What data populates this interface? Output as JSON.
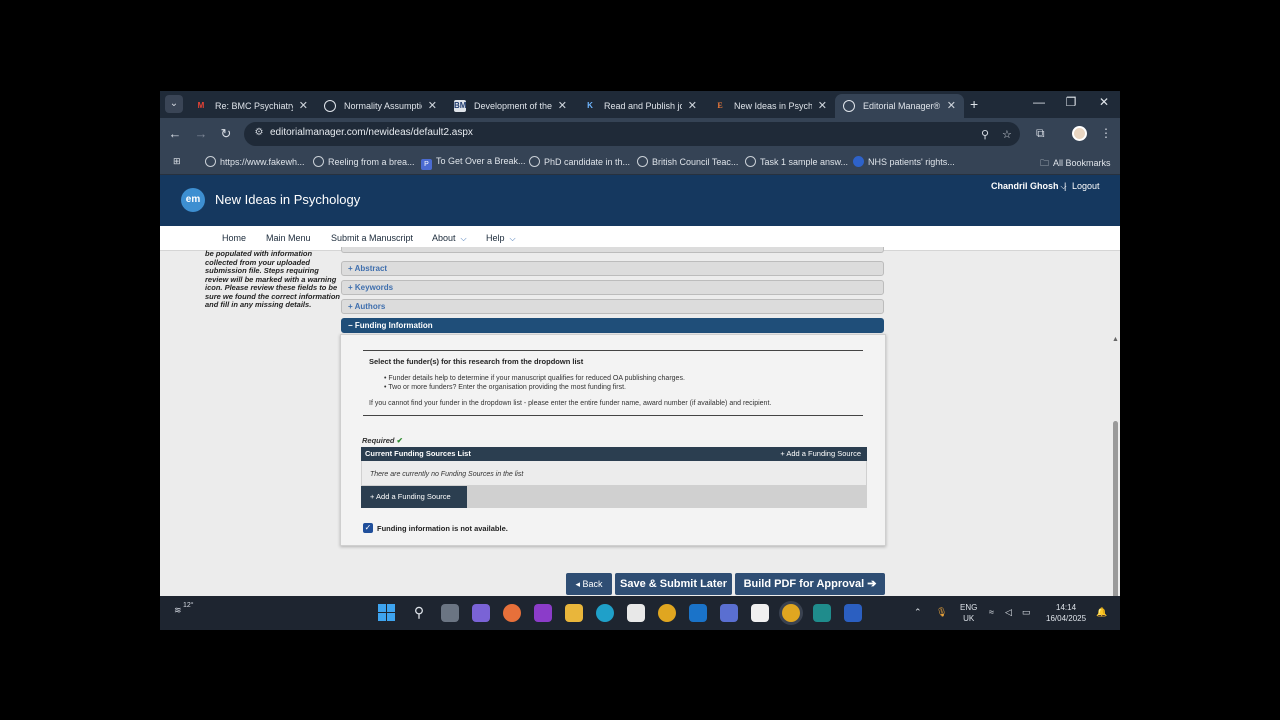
{
  "browser": {
    "tabs": [
      {
        "label": "Re: BMC Psychiatry-A",
        "icon": "gmail-icon",
        "active": false
      },
      {
        "label": "Normality Assumptio",
        "icon": "globe-icon",
        "active": false
      },
      {
        "label": "Development of the I",
        "icon": "bm-icon",
        "active": false
      },
      {
        "label": "Read and Publish jou",
        "icon": "k-icon",
        "active": false
      },
      {
        "label": "New Ideas in Psychol",
        "icon": "elsevier-icon",
        "active": false
      },
      {
        "label": "Editorial Manager®",
        "icon": "globe-icon",
        "active": true
      }
    ],
    "url": "editorialmanager.com/newideas/default2.aspx",
    "bookmarks": [
      "https://www.fakewh...",
      "Reeling from a brea...",
      "To Get Over a Break...",
      "PhD candidate in th...",
      "British Council Teac...",
      "Task 1 sample answ...",
      "NHS patients' rights..."
    ],
    "all_bookmarks": "All Bookmarks"
  },
  "site": {
    "logo_text": "em",
    "journal_title": "New Ideas in Psychology",
    "user_name": "Chandril Ghosh",
    "logout": "Logout",
    "nav": [
      "Home",
      "Main Menu",
      "Submit a Manuscript",
      "About",
      "Help"
    ]
  },
  "left_hint": "be populated with information collected from your uploaded submission file. Steps requiring review will be marked with a warning icon. Please review these fields to be sure we found the correct information and fill in any missing details.",
  "accordion": {
    "title_partial": "+ Title",
    "abstract": "+ Abstract",
    "keywords": "+ Keywords",
    "authors": "+ Authors",
    "funding": "− Funding Information"
  },
  "funding": {
    "prompt": "Select the funder(s) for this research from the dropdown list",
    "bullet1": "• Funder details help to determine if your manuscript qualifies for reduced OA publishing charges.",
    "bullet2": "• Two or more funders? Enter the organisation providing the most funding first.",
    "cannot_find": "If you cannot find your funder in the dropdown list - please enter the entire funder name, award number (if available) and recipient.",
    "required": "Required",
    "list_header": "Current Funding Sources List",
    "add_source_header": "+ Add a Funding Source",
    "empty_text": "There are currently no Funding Sources in the list",
    "add_source_button": "+ Add a Funding Source",
    "not_available_label": "Funding information is not available.",
    "not_available_checked": true
  },
  "actions": {
    "back": "◂ Back",
    "save": "Save & Submit Later",
    "pdf": "Build PDF for Approval ➔"
  },
  "taskbar": {
    "weather_temp": "12°",
    "lang_top": "ENG",
    "lang_bottom": "UK",
    "time": "14:14",
    "date": "16/04/2025"
  },
  "colors": {
    "header": "#15385f",
    "accent_button": "#2f4e74"
  }
}
